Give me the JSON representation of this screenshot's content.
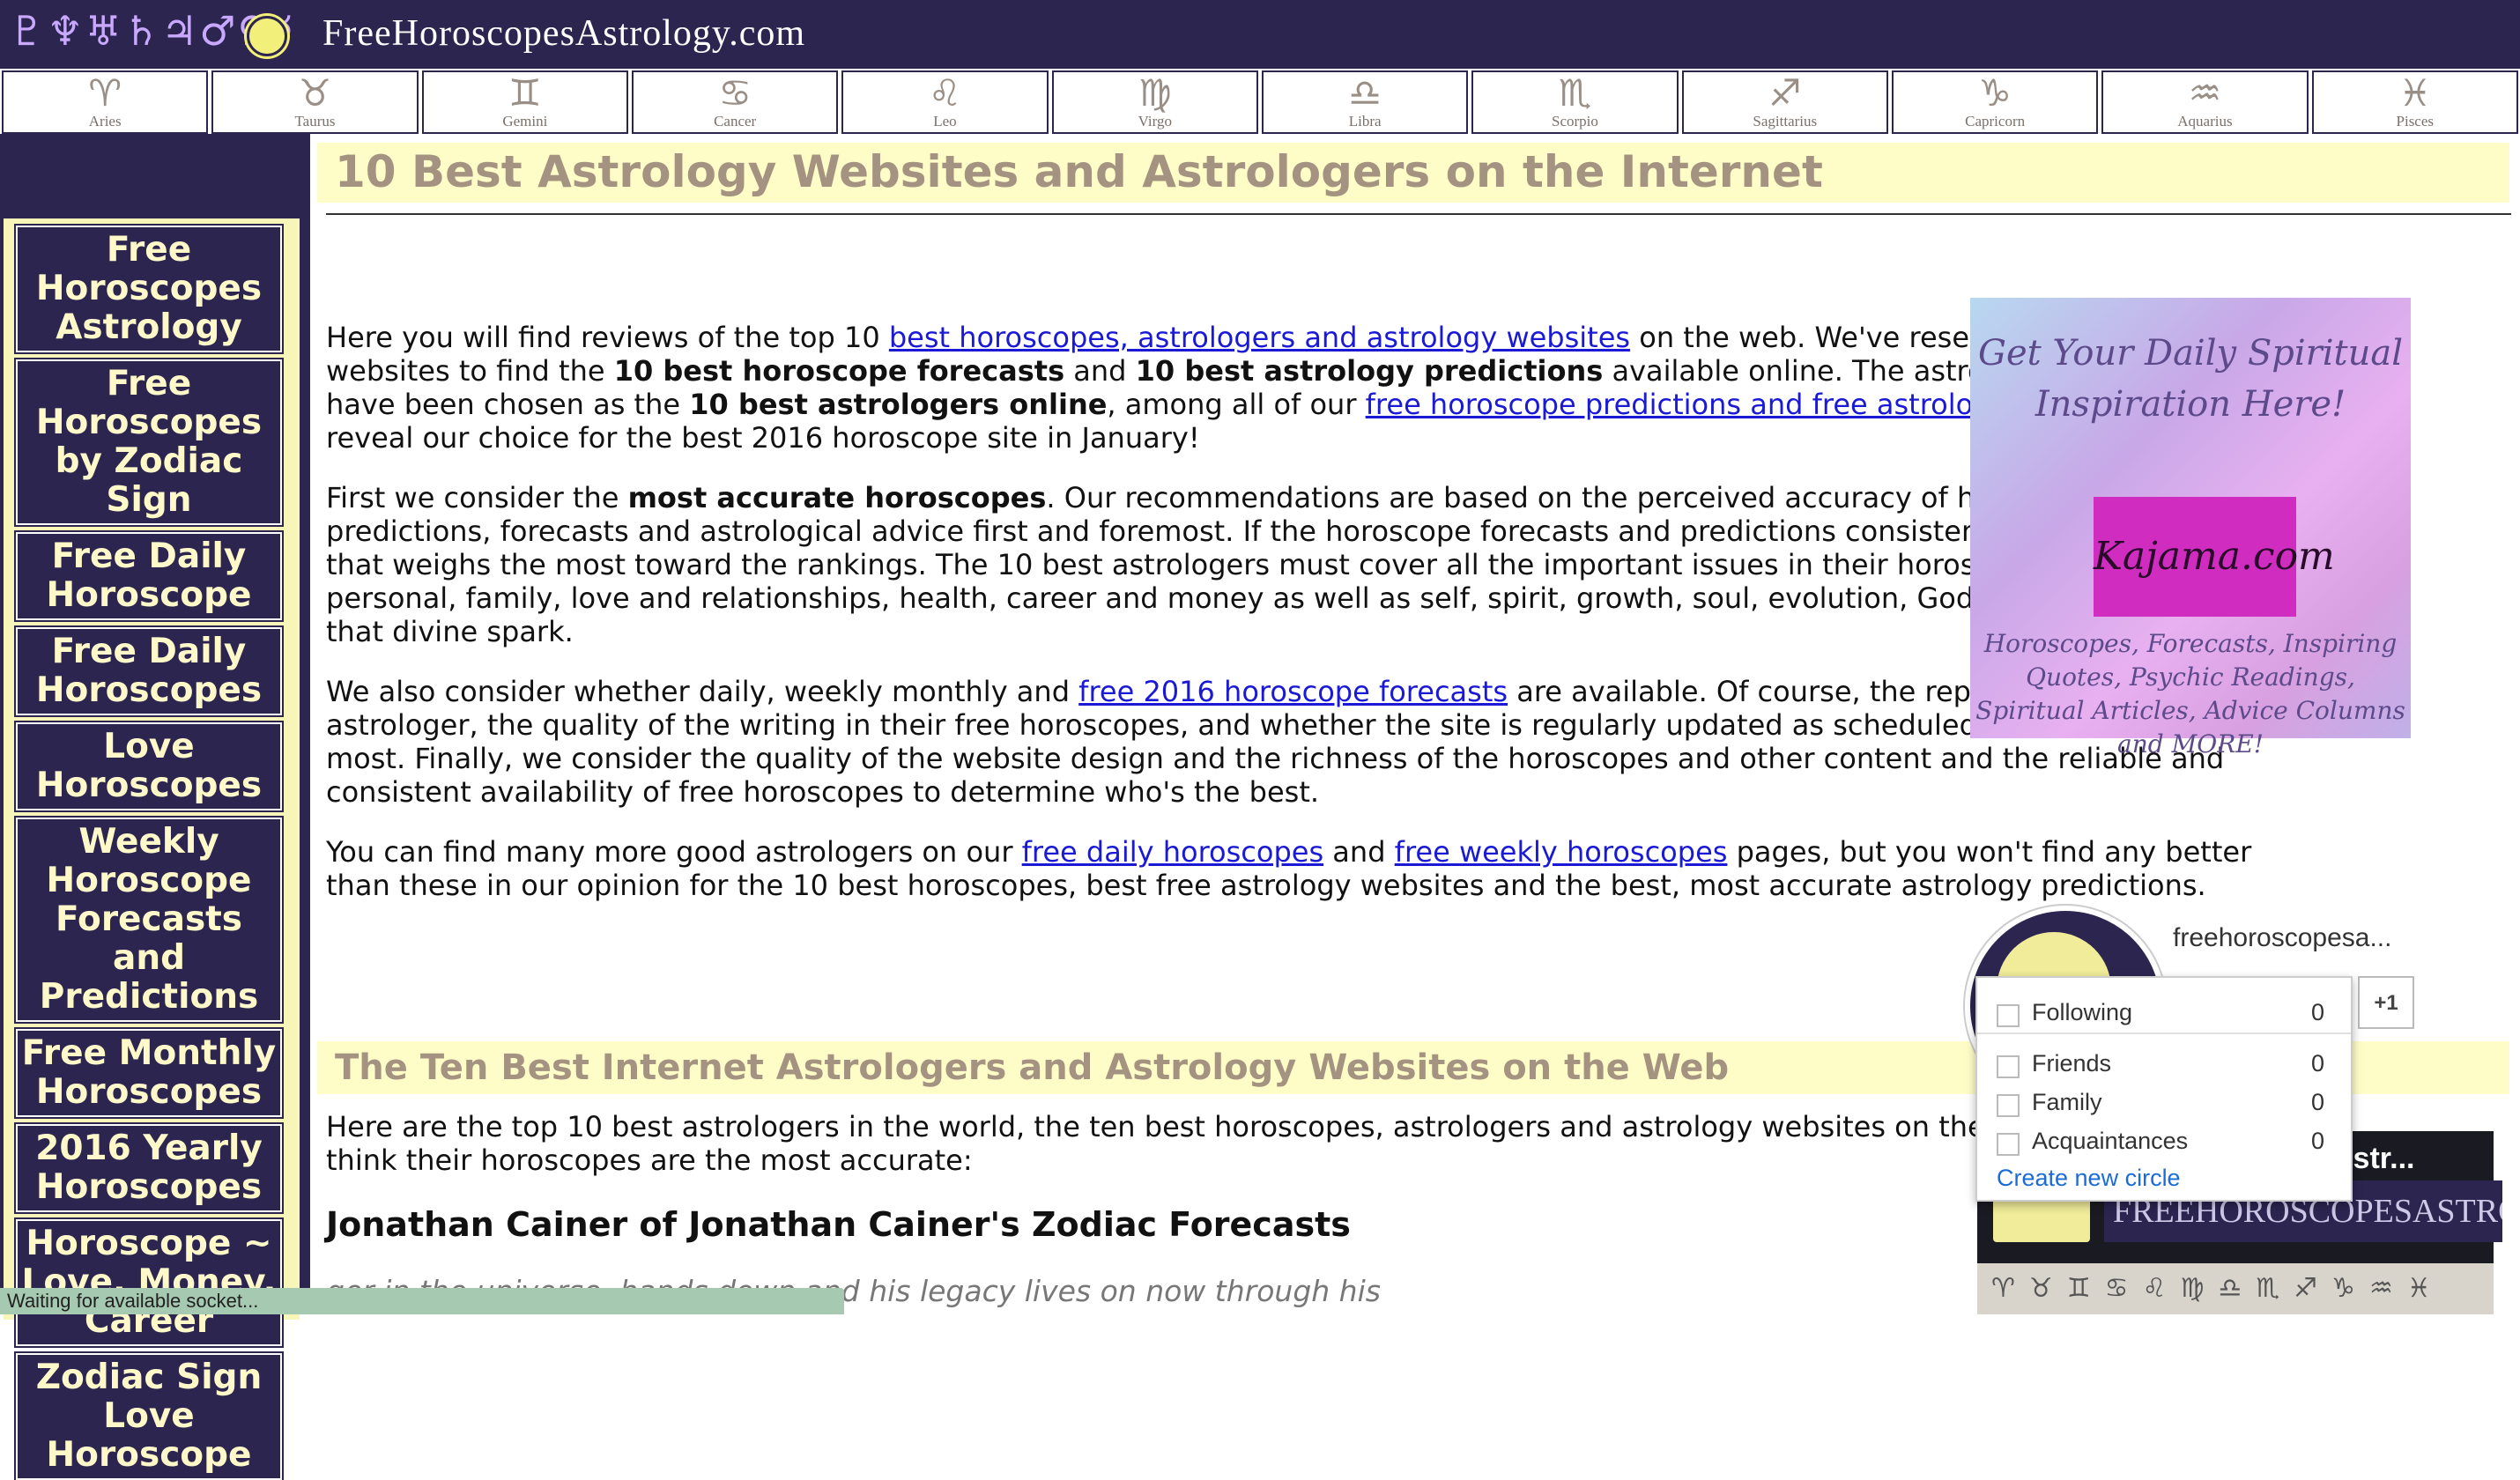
{
  "header": {
    "glyphs": "♇♆♅♄♃♂♀☿",
    "site_title": "FreeHoroscopesAstrology.com"
  },
  "zodiac": [
    {
      "symbol": "♈",
      "name": "Aries"
    },
    {
      "symbol": "♉",
      "name": "Taurus"
    },
    {
      "symbol": "♊",
      "name": "Gemini"
    },
    {
      "symbol": "♋",
      "name": "Cancer"
    },
    {
      "symbol": "♌",
      "name": "Leo"
    },
    {
      "symbol": "♍",
      "name": "Virgo"
    },
    {
      "symbol": "♎",
      "name": "Libra"
    },
    {
      "symbol": "♏",
      "name": "Scorpio"
    },
    {
      "symbol": "♐",
      "name": "Sagittarius"
    },
    {
      "symbol": "♑",
      "name": "Capricorn"
    },
    {
      "symbol": "♒",
      "name": "Aquarius"
    },
    {
      "symbol": "♓",
      "name": "Pisces"
    }
  ],
  "nav": [
    "Free Horoscopes Astrology",
    "Free Horoscopes by Zodiac Sign",
    "Free Daily Horoscope",
    "Free Daily Horoscopes",
    "Love Horoscopes",
    "Weekly Horoscope Forecasts and Predictions",
    "Free Monthly Horoscopes",
    "2016 Yearly Horoscopes",
    "Horoscope ~ Love, Money, Career",
    "Zodiac Sign Love Horoscope"
  ],
  "page_title": "10 Best Astrology Websites and Astrologers on the Internet",
  "p1": {
    "t1": "Here you will find reviews of the top 10 ",
    "link1": "best horoscopes, astrologers and astrology websites",
    "t2": " on the web. We've researched hundreds of websites to find the ",
    "b1": "10 best horoscope forecasts",
    "t3": " and ",
    "b2": "10 best astrology predictions",
    "t4": " available online. The astrologers on this page have been chosen as the ",
    "b3": "10 best astrologers online",
    "t5": ", among all of our ",
    "link2": "free horoscope predictions and free astrology forecasts",
    "t6": ". We'll reveal our choice for the best 2016 horoscope site in January!"
  },
  "p2": {
    "t1": "First we consider the ",
    "b1": "most accurate horoscopes",
    "t2": ". Our recommendations are based on the perceived accuracy of horoscope predictions, forecasts and astrological advice first and foremost. If the horoscope forecasts and predictions consistently feel accurate, that weighs the most toward the rankings. The 10 best astrologers must cover all the important issues in their horoscopes including personal, family, love and relationships, health, career and money as well as self, spirit, growth, soul, evolution, God or whatever you call that divine spark."
  },
  "p3": {
    "t1": "We also consider whether daily, weekly monthly and ",
    "link1": "free 2016 horoscope forecasts",
    "t2": " are available. Of course, the reputation of the astrologer, the quality of the writing in their free horoscopes, and whether the site is regularly updated as scheduled matters second most. Finally, we consider the quality of the website design and the richness of the horoscopes and other content and the reliable and consistent availability of free horoscopes to determine who's the best."
  },
  "p4": {
    "t1": "You can find many more good astrologers on our ",
    "link1": "free daily horoscopes",
    "t2": " and ",
    "link2": "free weekly horoscopes",
    "t3": " pages, but you won't find any better than these in our opinion for the 10 best horoscopes, best free astrology websites and the best, most accurate astrology predictions."
  },
  "section2_title": "The Ten Best Internet Astrologers and Astrology Websites on the Web",
  "p5": "Here are the top 10 best astrologers in the world, the ten best horoscopes, astrologers and astrology websites on the web and why we think their horoscopes are the most accurate:",
  "h3": "Jonathan Cainer of Jonathan Cainer's Zodiac Forecasts",
  "italic_text": "ger in the universe, hands down and his legacy lives on now through his",
  "ad": {
    "top": "Get Your Daily Spiritual Inspiration Here!",
    "brand": "Kajama.com",
    "bottom": "Horoscopes, Forecasts, Inspiring Quotes, Psychic Readings, Spiritual Articles, Advice Columns and MORE!"
  },
  "gplus": {
    "name": "freehoroscopesa...",
    "plus_label": "+1",
    "circles": [
      {
        "label": "Following",
        "count": "0"
      },
      {
        "label": "Friends",
        "count": "0"
      },
      {
        "label": "Family",
        "count": "0"
      },
      {
        "label": "Acquaintances",
        "count": "0"
      }
    ],
    "create": "Create new circle",
    "low_text": "Astr...",
    "low_banner": "FREEHOROSCOPESASTROLO",
    "low_strip": "♈♉♊♋♌♍♎♏♐♑♒♓"
  },
  "status": "Waiting for available socket...",
  "colors": {
    "navy": "#2b2550",
    "cream": "#fffdc7",
    "title_text": "#a59382",
    "link": "#1a1ad6"
  }
}
